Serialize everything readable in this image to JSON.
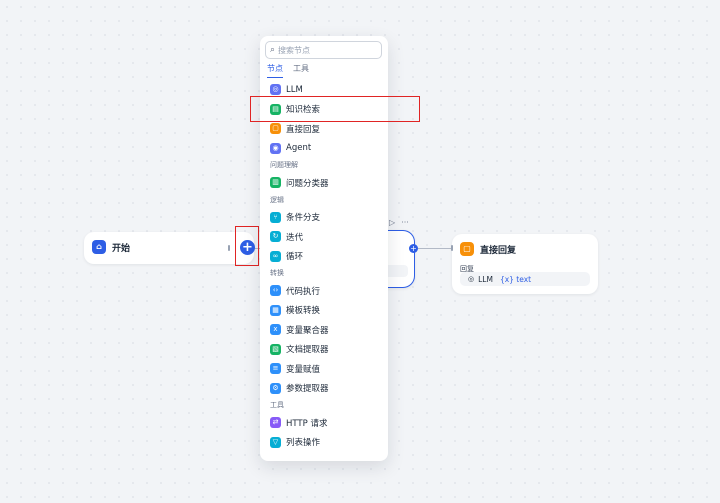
{
  "canvas": {
    "start_node": {
      "title": "开始",
      "icon": "home-icon",
      "color": "#2e5ee5"
    },
    "answer_node": {
      "title": "直接回复",
      "icon": "message-icon",
      "color": "#f79009",
      "body_label": "回复",
      "llm_label": "LLM",
      "var_label": "{x} text"
    },
    "mid_node_tools": {
      "run": "▷",
      "more": "···"
    }
  },
  "panel": {
    "search_placeholder": "搜索节点",
    "tabs": [
      {
        "label": "节点",
        "active": true
      },
      {
        "label": "工具",
        "active": false
      }
    ],
    "items": [
      {
        "type": "item",
        "label": "LLM",
        "icon": "llm-icon",
        "color": "#6172f3",
        "glyph": "◎"
      },
      {
        "type": "item",
        "label": "知识检索",
        "icon": "knowledge-retrieval-icon",
        "color": "#16b364",
        "glyph": "▤"
      },
      {
        "type": "item",
        "label": "直接回复",
        "icon": "answer-icon",
        "color": "#f79009",
        "glyph": "▢"
      },
      {
        "type": "item",
        "label": "Agent",
        "icon": "agent-icon",
        "color": "#6172f3",
        "glyph": "◉"
      },
      {
        "type": "section",
        "label": "问题理解"
      },
      {
        "type": "item",
        "label": "问题分类器",
        "icon": "question-classifier-icon",
        "color": "#16b364",
        "glyph": "▥"
      },
      {
        "type": "section",
        "label": "逻辑"
      },
      {
        "type": "item",
        "label": "条件分支",
        "icon": "if-else-icon",
        "color": "#06aed4",
        "glyph": "⑂"
      },
      {
        "type": "item",
        "label": "迭代",
        "icon": "iteration-icon",
        "color": "#06aed4",
        "glyph": "↻"
      },
      {
        "type": "item",
        "label": "循环",
        "icon": "loop-icon",
        "color": "#06aed4",
        "glyph": "∞"
      },
      {
        "type": "section",
        "label": "转换"
      },
      {
        "type": "item",
        "label": "代码执行",
        "icon": "code-icon",
        "color": "#2e90fa",
        "glyph": "‹›"
      },
      {
        "type": "item",
        "label": "模板转换",
        "icon": "template-icon",
        "color": "#2e90fa",
        "glyph": "▦"
      },
      {
        "type": "item",
        "label": "变量聚合器",
        "icon": "variable-aggregator-icon",
        "color": "#2e90fa",
        "glyph": "x"
      },
      {
        "type": "item",
        "label": "文档提取器",
        "icon": "doc-extractor-icon",
        "color": "#16b364",
        "glyph": "▧"
      },
      {
        "type": "item",
        "label": "变量赋值",
        "icon": "variable-assigner-icon",
        "color": "#2e90fa",
        "glyph": "≡"
      },
      {
        "type": "item",
        "label": "参数提取器",
        "icon": "parameter-extractor-icon",
        "color": "#2e90fa",
        "glyph": "⚙"
      },
      {
        "type": "section",
        "label": "工具"
      },
      {
        "type": "item",
        "label": "HTTP 请求",
        "icon": "http-icon",
        "color": "#875bf7",
        "glyph": "⇄"
      },
      {
        "type": "item",
        "label": "列表操作",
        "icon": "list-operator-icon",
        "color": "#06aed4",
        "glyph": "▽"
      }
    ]
  }
}
